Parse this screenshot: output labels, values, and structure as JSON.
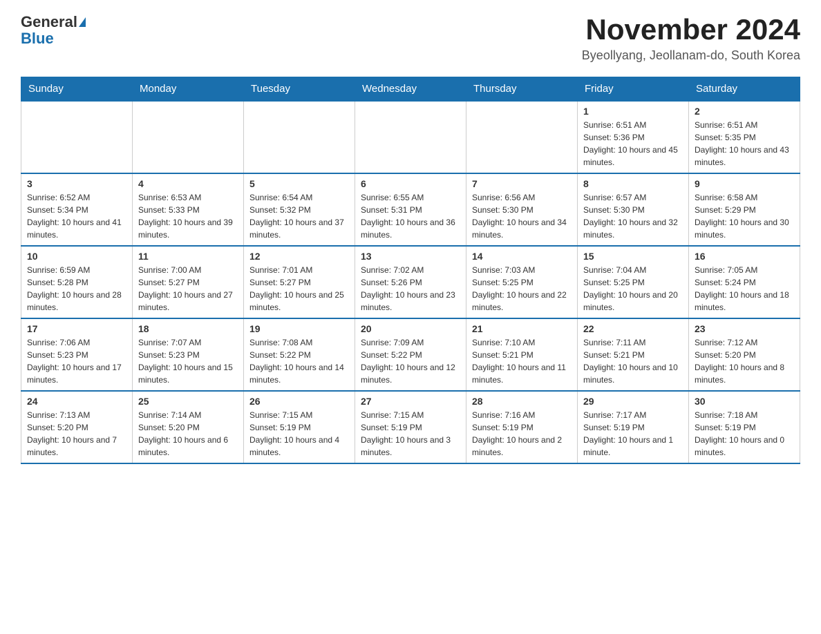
{
  "header": {
    "logo_general": "General",
    "logo_blue": "Blue",
    "month_title": "November 2024",
    "location": "Byeollyang, Jeollanam-do, South Korea"
  },
  "days_of_week": [
    "Sunday",
    "Monday",
    "Tuesday",
    "Wednesday",
    "Thursday",
    "Friday",
    "Saturday"
  ],
  "weeks": [
    [
      {
        "day": "",
        "info": ""
      },
      {
        "day": "",
        "info": ""
      },
      {
        "day": "",
        "info": ""
      },
      {
        "day": "",
        "info": ""
      },
      {
        "day": "",
        "info": ""
      },
      {
        "day": "1",
        "info": "Sunrise: 6:51 AM\nSunset: 5:36 PM\nDaylight: 10 hours and 45 minutes."
      },
      {
        "day": "2",
        "info": "Sunrise: 6:51 AM\nSunset: 5:35 PM\nDaylight: 10 hours and 43 minutes."
      }
    ],
    [
      {
        "day": "3",
        "info": "Sunrise: 6:52 AM\nSunset: 5:34 PM\nDaylight: 10 hours and 41 minutes."
      },
      {
        "day": "4",
        "info": "Sunrise: 6:53 AM\nSunset: 5:33 PM\nDaylight: 10 hours and 39 minutes."
      },
      {
        "day": "5",
        "info": "Sunrise: 6:54 AM\nSunset: 5:32 PM\nDaylight: 10 hours and 37 minutes."
      },
      {
        "day": "6",
        "info": "Sunrise: 6:55 AM\nSunset: 5:31 PM\nDaylight: 10 hours and 36 minutes."
      },
      {
        "day": "7",
        "info": "Sunrise: 6:56 AM\nSunset: 5:30 PM\nDaylight: 10 hours and 34 minutes."
      },
      {
        "day": "8",
        "info": "Sunrise: 6:57 AM\nSunset: 5:30 PM\nDaylight: 10 hours and 32 minutes."
      },
      {
        "day": "9",
        "info": "Sunrise: 6:58 AM\nSunset: 5:29 PM\nDaylight: 10 hours and 30 minutes."
      }
    ],
    [
      {
        "day": "10",
        "info": "Sunrise: 6:59 AM\nSunset: 5:28 PM\nDaylight: 10 hours and 28 minutes."
      },
      {
        "day": "11",
        "info": "Sunrise: 7:00 AM\nSunset: 5:27 PM\nDaylight: 10 hours and 27 minutes."
      },
      {
        "day": "12",
        "info": "Sunrise: 7:01 AM\nSunset: 5:27 PM\nDaylight: 10 hours and 25 minutes."
      },
      {
        "day": "13",
        "info": "Sunrise: 7:02 AM\nSunset: 5:26 PM\nDaylight: 10 hours and 23 minutes."
      },
      {
        "day": "14",
        "info": "Sunrise: 7:03 AM\nSunset: 5:25 PM\nDaylight: 10 hours and 22 minutes."
      },
      {
        "day": "15",
        "info": "Sunrise: 7:04 AM\nSunset: 5:25 PM\nDaylight: 10 hours and 20 minutes."
      },
      {
        "day": "16",
        "info": "Sunrise: 7:05 AM\nSunset: 5:24 PM\nDaylight: 10 hours and 18 minutes."
      }
    ],
    [
      {
        "day": "17",
        "info": "Sunrise: 7:06 AM\nSunset: 5:23 PM\nDaylight: 10 hours and 17 minutes."
      },
      {
        "day": "18",
        "info": "Sunrise: 7:07 AM\nSunset: 5:23 PM\nDaylight: 10 hours and 15 minutes."
      },
      {
        "day": "19",
        "info": "Sunrise: 7:08 AM\nSunset: 5:22 PM\nDaylight: 10 hours and 14 minutes."
      },
      {
        "day": "20",
        "info": "Sunrise: 7:09 AM\nSunset: 5:22 PM\nDaylight: 10 hours and 12 minutes."
      },
      {
        "day": "21",
        "info": "Sunrise: 7:10 AM\nSunset: 5:21 PM\nDaylight: 10 hours and 11 minutes."
      },
      {
        "day": "22",
        "info": "Sunrise: 7:11 AM\nSunset: 5:21 PM\nDaylight: 10 hours and 10 minutes."
      },
      {
        "day": "23",
        "info": "Sunrise: 7:12 AM\nSunset: 5:20 PM\nDaylight: 10 hours and 8 minutes."
      }
    ],
    [
      {
        "day": "24",
        "info": "Sunrise: 7:13 AM\nSunset: 5:20 PM\nDaylight: 10 hours and 7 minutes."
      },
      {
        "day": "25",
        "info": "Sunrise: 7:14 AM\nSunset: 5:20 PM\nDaylight: 10 hours and 6 minutes."
      },
      {
        "day": "26",
        "info": "Sunrise: 7:15 AM\nSunset: 5:19 PM\nDaylight: 10 hours and 4 minutes."
      },
      {
        "day": "27",
        "info": "Sunrise: 7:15 AM\nSunset: 5:19 PM\nDaylight: 10 hours and 3 minutes."
      },
      {
        "day": "28",
        "info": "Sunrise: 7:16 AM\nSunset: 5:19 PM\nDaylight: 10 hours and 2 minutes."
      },
      {
        "day": "29",
        "info": "Sunrise: 7:17 AM\nSunset: 5:19 PM\nDaylight: 10 hours and 1 minute."
      },
      {
        "day": "30",
        "info": "Sunrise: 7:18 AM\nSunset: 5:19 PM\nDaylight: 10 hours and 0 minutes."
      }
    ]
  ]
}
